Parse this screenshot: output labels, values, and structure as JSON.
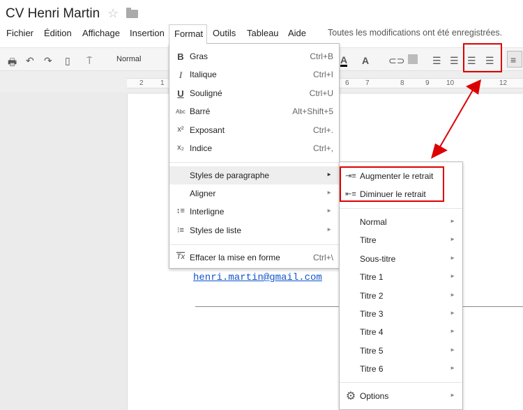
{
  "document": {
    "title": "CV Henri Martin",
    "star_icon": "star-icon",
    "folder_icon": "folder-icon",
    "email": "henri.martin@gmail.com"
  },
  "menubar": {
    "items": [
      "Fichier",
      "Édition",
      "Affichage",
      "Insertion",
      "Format",
      "Outils",
      "Tableau",
      "Aide"
    ],
    "status": "Toutes les modifications ont été enregistrées."
  },
  "toolbar": {
    "style": "Normal",
    "icons": [
      "print-icon",
      "undo-icon",
      "redo-icon",
      "paste-format-icon",
      "paint-format-icon",
      "text-color-icon",
      "highlight-icon",
      "link-icon",
      "image-icon",
      "numbered-list-icon",
      "bulleted-list-icon",
      "decrease-indent-icon",
      "increase-indent-icon",
      "align-left-icon"
    ]
  },
  "ruler": {
    "ticks": [
      "2",
      "1",
      "6",
      "7",
      "8",
      "9",
      "10",
      "12"
    ]
  },
  "format_menu": {
    "items": [
      {
        "icon": "B",
        "label": "Gras",
        "shortcut": "Ctrl+B"
      },
      {
        "icon": "I",
        "label": "Italique",
        "shortcut": "Ctrl+I"
      },
      {
        "icon": "U",
        "label": "Souligné",
        "shortcut": "Ctrl+U"
      },
      {
        "icon": "Abc",
        "label": "Barré",
        "shortcut": "Alt+Shift+5"
      },
      {
        "icon": "x²",
        "label": "Exposant",
        "shortcut": "Ctrl+."
      },
      {
        "icon": "x₂",
        "label": "Indice",
        "shortcut": "Ctrl+,"
      },
      {
        "icon": "",
        "label": "Styles de paragraphe",
        "arrow": "►"
      },
      {
        "icon": "",
        "label": "Aligner",
        "arrow": "►"
      },
      {
        "icon": "↕≡",
        "label": "Interligne",
        "arrow": "►"
      },
      {
        "icon": "⁝≡",
        "label": "Styles de liste",
        "arrow": "►"
      },
      {
        "icon": "Tx",
        "label": "Effacer la mise en forme",
        "shortcut": "Ctrl+\\"
      }
    ]
  },
  "paragraph_submenu": {
    "indent": [
      {
        "icon": "⇥≡",
        "label": "Augmenter le retrait"
      },
      {
        "icon": "⇤≡",
        "label": "Diminuer le retrait"
      }
    ],
    "styles": [
      "Normal",
      "Titre",
      "Sous-titre",
      "Titre 1",
      "Titre 2",
      "Titre 3",
      "Titre 4",
      "Titre 5",
      "Titre 6"
    ],
    "options": "Options",
    "arrow": "►"
  },
  "colors": {
    "annotation": "#dd0000",
    "link": "#1155cc"
  }
}
